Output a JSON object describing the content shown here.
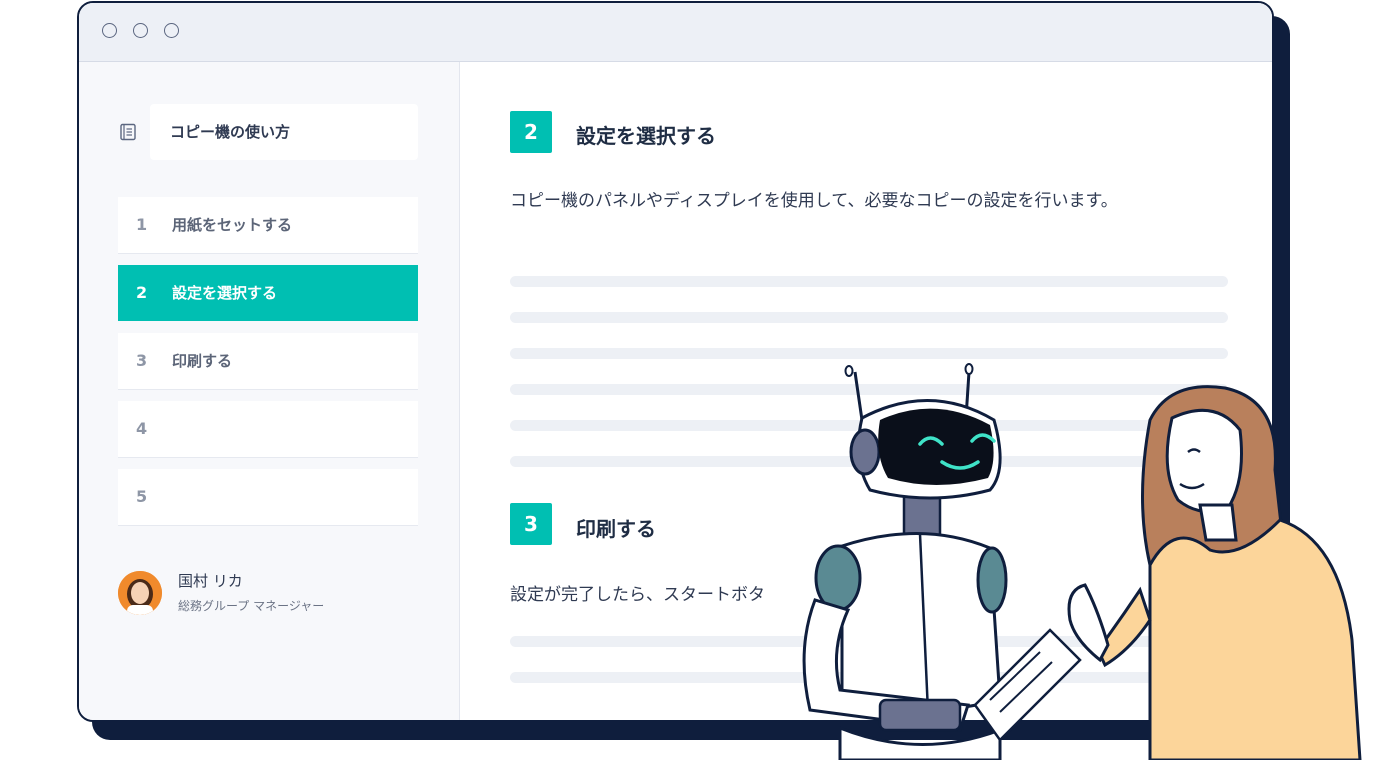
{
  "window": {
    "dots": [
      "window-dot-1",
      "window-dot-2",
      "window-dot-3"
    ]
  },
  "sidebar": {
    "doc_title": "コピー機の使い方",
    "doc_icon": "document-icon",
    "steps": [
      {
        "num": "1",
        "label": "用紙をセットする",
        "active": false
      },
      {
        "num": "2",
        "label": "設定を選択する",
        "active": true
      },
      {
        "num": "3",
        "label": "印刷する",
        "active": false
      },
      {
        "num": "4",
        "label": "",
        "active": false
      },
      {
        "num": "5",
        "label": "",
        "active": false
      }
    ],
    "user": {
      "name": "国村 リカ",
      "role": "総務グループ マネージャー"
    }
  },
  "main": {
    "sections": [
      {
        "num": "2",
        "heading": "設定を選択する",
        "text": "コピー機のパネルやディスプレイを使用して、必要なコピーの設定を行います。"
      },
      {
        "num": "3",
        "heading": "印刷する",
        "text": "設定が完了したら、スタートボタ"
      }
    ]
  },
  "colors": {
    "accent": "#00bfb2",
    "navy": "#0f1e3d",
    "sidebar_bg": "#f7f8fb",
    "placeholder_bar": "#edf0f5"
  }
}
